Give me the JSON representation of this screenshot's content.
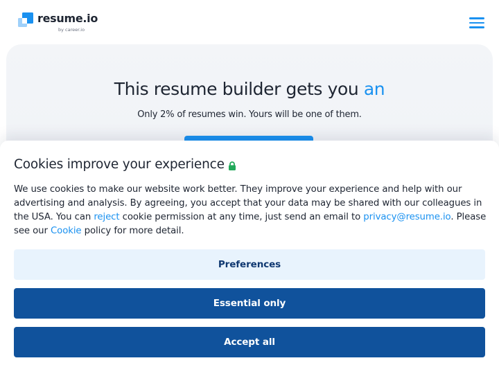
{
  "header": {
    "logo_text": "resume.io",
    "logo_sub": "by career.io",
    "menu_icon": "hamburger-menu-icon"
  },
  "hero": {
    "title_main": "This resume builder gets you ",
    "title_accent": "an",
    "subtitle": "Only 2% of resumes win. Yours will be one of them."
  },
  "cookie_banner": {
    "title": "Cookies improve your experience",
    "title_icon": "lock-icon",
    "text_part1": "We use cookies to make our website work better. They improve your experience and help with our advertising and analysis. By agreeing, you accept that your data may be shared with our colleagues in the USA. You can ",
    "reject_link": "reject",
    "text_part2": " cookie permission at any time, just send an email to ",
    "email_link": "privacy@resume.io",
    "text_part3": ". Please see our ",
    "cookie_link": "Cookie",
    "text_part4": " policy for more detail.",
    "preferences_label": "Preferences",
    "essential_label": "Essential only",
    "accept_label": "Accept all"
  },
  "colors": {
    "accent": "#1a91f0",
    "primary_button": "#10529c",
    "secondary_button": "#e8f3fd",
    "lock_icon": "#22a95a"
  }
}
